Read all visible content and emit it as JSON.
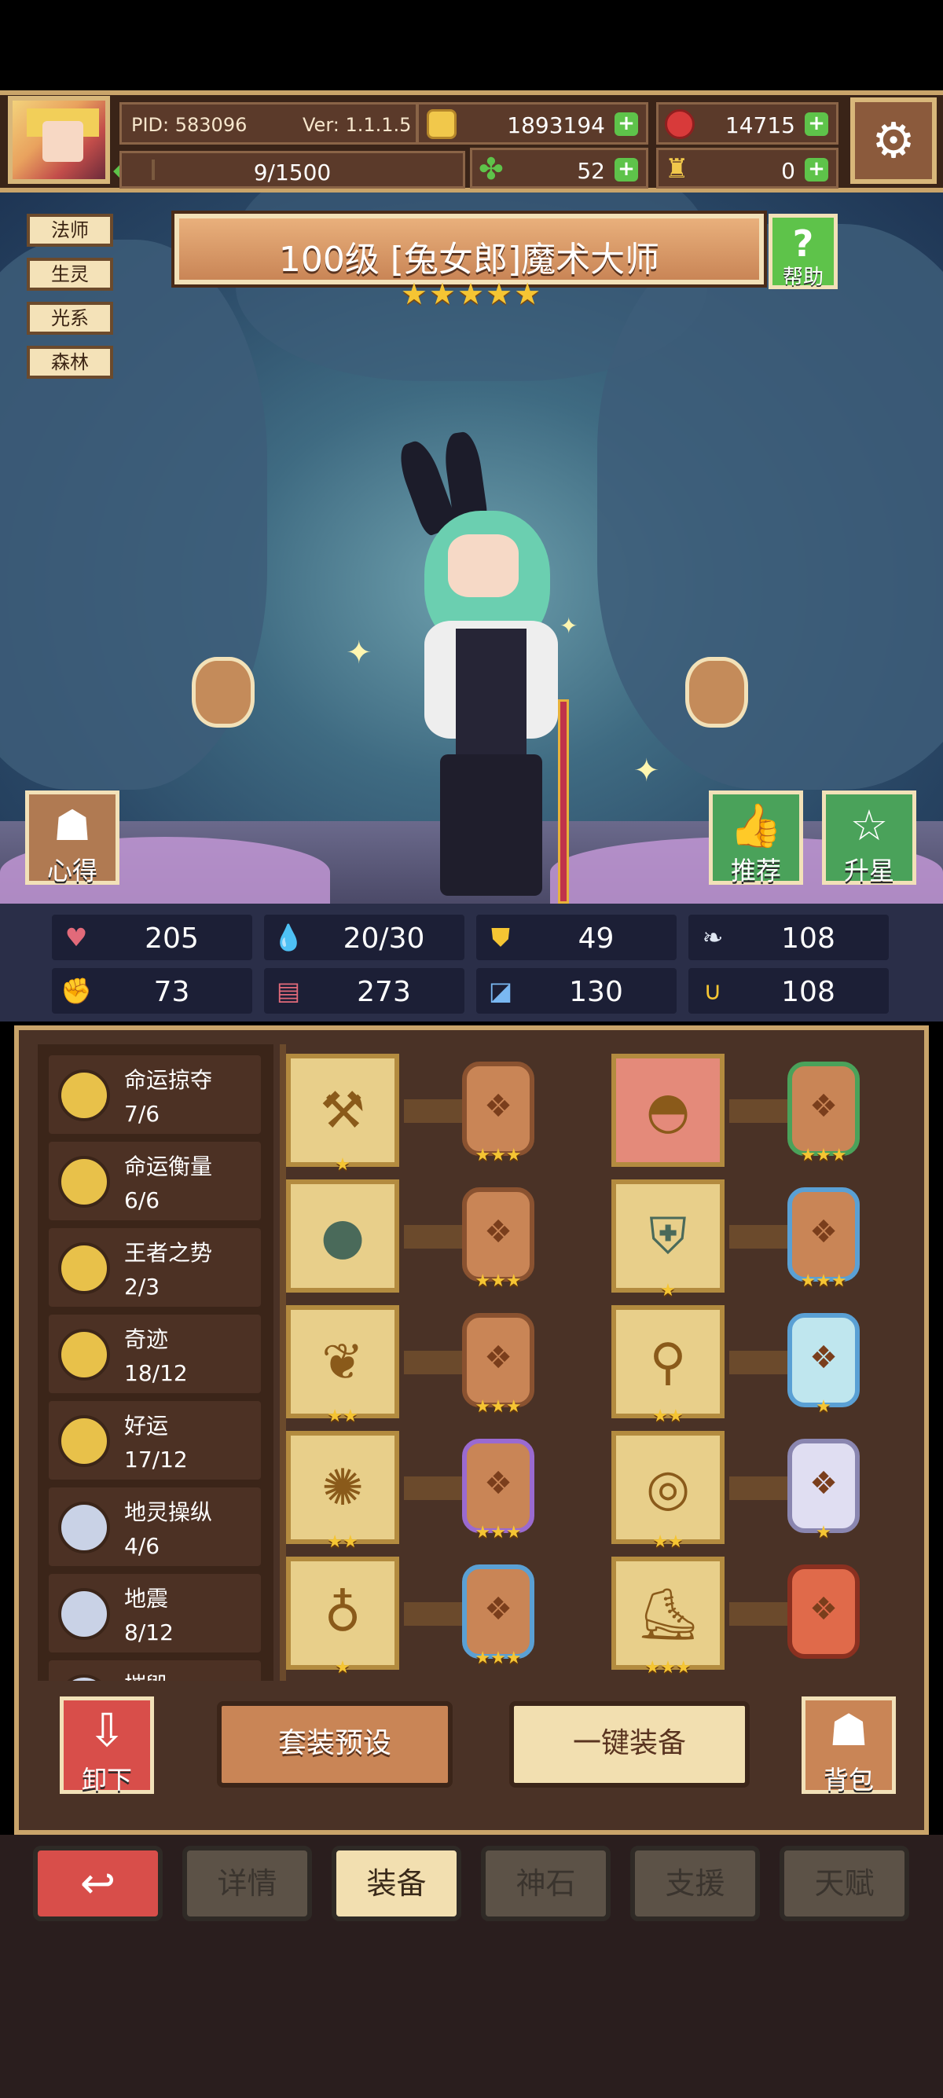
{
  "header": {
    "pid": "PID: 583096",
    "version": "Ver: 1.1.1.5",
    "gold": "1893194",
    "rubies": "14715",
    "energy": "9/1500",
    "energy_fraction": 0.006,
    "clover": "52",
    "bag_items": "0"
  },
  "hero": {
    "tags": [
      "法师",
      "生灵",
      "光系",
      "森林"
    ],
    "title": "100级 [兔女郎]魔术大师",
    "stars": "★★★★★",
    "help_label": "帮助",
    "insight_label": "心得",
    "recommend_label": "推荐",
    "star_up_label": "升星"
  },
  "stats": [
    {
      "icon": "heart-icon",
      "value": "205"
    },
    {
      "icon": "mana-drop-icon",
      "value": "20/30"
    },
    {
      "icon": "shield-icon",
      "value": "49"
    },
    {
      "icon": "wing-icon",
      "value": "108"
    },
    {
      "icon": "fist-icon",
      "value": "73"
    },
    {
      "icon": "spellbook-icon",
      "value": "273"
    },
    {
      "icon": "boot-icon",
      "value": "130"
    },
    {
      "icon": "horseshoe-icon",
      "value": "108"
    }
  ],
  "sets": [
    {
      "name": "命运掠夺",
      "count": "7/6",
      "tier": "gold"
    },
    {
      "name": "命运衡量",
      "count": "6/6",
      "tier": "gold"
    },
    {
      "name": "王者之势",
      "count": "2/3",
      "tier": "gold"
    },
    {
      "name": "奇迹",
      "count": "18/12",
      "tier": "gold"
    },
    {
      "name": "好运",
      "count": "17/12",
      "tier": "gold"
    },
    {
      "name": "地灵操纵",
      "count": "4/6",
      "tier": "silver"
    },
    {
      "name": "地震",
      "count": "8/12",
      "tier": "silver"
    },
    {
      "name": "摧毁",
      "count": "",
      "tier": "silver"
    }
  ],
  "equipment": [
    {
      "item": "axe",
      "item_stars": "★",
      "rune": "bronze",
      "rune_stars": "★★★"
    },
    {
      "item": "hat",
      "item_stars": "",
      "rune": "green",
      "rune_stars": "★★★"
    },
    {
      "item": "orb",
      "item_stars": "",
      "rune": "bronze",
      "rune_stars": "★★★"
    },
    {
      "item": "armor",
      "item_stars": "★",
      "rune": "blue",
      "rune_stars": "★★★"
    },
    {
      "item": "necklace",
      "item_stars": "★★",
      "rune": "bronze",
      "rune_stars": "★★★"
    },
    {
      "item": "scroll",
      "item_stars": "★★",
      "rune": "cyan",
      "rune_stars": "★"
    },
    {
      "item": "amulet",
      "item_stars": "★★",
      "rune": "purple",
      "rune_stars": "★★★"
    },
    {
      "item": "ring",
      "item_stars": "★★",
      "rune": "silver",
      "rune_stars": "★"
    },
    {
      "item": "crown-ring",
      "item_stars": "★",
      "rune": "blue",
      "rune_stars": "★★★"
    },
    {
      "item": "boots",
      "item_stars": "★★★",
      "rune": "orange",
      "rune_stars": ""
    }
  ],
  "actions": {
    "unequip": "卸下",
    "preset": "套装预设",
    "one_click": "一键装备",
    "bag": "背包"
  },
  "nav": {
    "details": "详情",
    "equip": "装备",
    "godstone": "神石",
    "support": "支援",
    "talent": "天赋",
    "active": "equip"
  }
}
